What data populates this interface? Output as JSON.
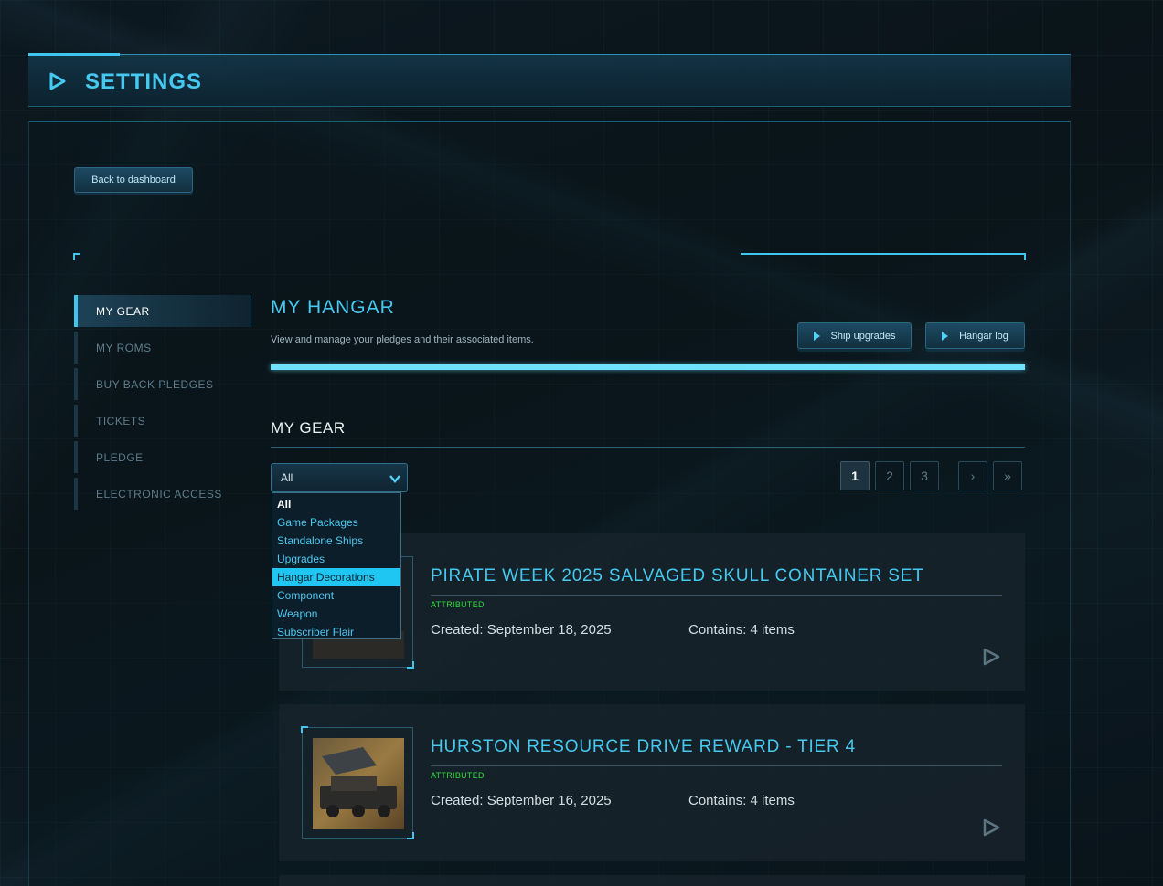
{
  "header": {
    "title": "SETTINGS",
    "icon": "play-icon"
  },
  "back_button": {
    "label": "Back to dashboard"
  },
  "sidebar": {
    "items": [
      {
        "label": "MY GEAR",
        "active": true
      },
      {
        "label": "MY ROMS",
        "active": false
      },
      {
        "label": "BUY BACK PLEDGES",
        "active": false
      },
      {
        "label": "TICKETS",
        "active": false
      },
      {
        "label": "PLEDGE",
        "active": false
      },
      {
        "label": "ELECTRONIC ACCESS",
        "active": false
      }
    ]
  },
  "main": {
    "title": "MY HANGAR",
    "subtitle": "View and manage your pledges and their associated items.",
    "buttons": {
      "ship_upgrades": "Ship upgrades",
      "hangar_log": "Hangar log"
    },
    "section_title": "MY GEAR"
  },
  "filter": {
    "selected": "All",
    "options": [
      "All",
      "Game Packages",
      "Standalone Ships",
      "Upgrades",
      "Hangar Decorations",
      "Component",
      "Weapon",
      "Subscriber Flair"
    ],
    "highlighted": "Hangar Decorations"
  },
  "pagination": {
    "pages": [
      "1",
      "2",
      "3"
    ],
    "current": "1",
    "next": "›",
    "last": "»"
  },
  "items": [
    {
      "title": "PIRATE WEEK 2025 SALVAGED SKULL CONTAINER SET",
      "status": "ATTRIBUTED",
      "created": "Created: September 18, 2025",
      "contains": "Contains: 4 items"
    },
    {
      "title": "HURSTON RESOURCE DRIVE REWARD - TIER 4",
      "status": "ATTRIBUTED",
      "created": "Created: September 16, 2025",
      "contains": "Contains: 4 items"
    }
  ],
  "colors": {
    "accent": "#45c9f0",
    "status": "#2fdc3a",
    "highlight": "#1fc6f2"
  }
}
